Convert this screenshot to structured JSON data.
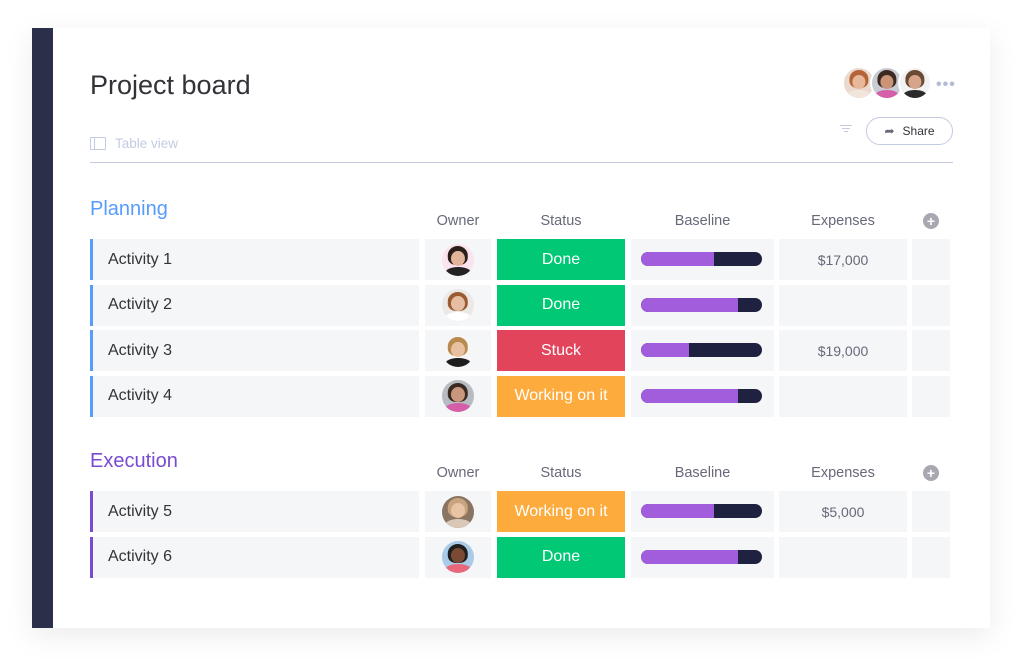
{
  "header": {
    "title": "Project board",
    "view_label": "Table view",
    "share_label": "Share",
    "more_label": "•••",
    "add_column_label": "+",
    "members": [
      {
        "name": "member-1",
        "bg": "#e9d9cf",
        "hair": "#b5643a",
        "skin": "#e8b89a",
        "shirt": "#f1e5dc"
      },
      {
        "name": "member-2",
        "bg": "#c9ccd4",
        "hair": "#3b2a20",
        "skin": "#c99478",
        "shirt": "#d45fa8"
      },
      {
        "name": "member-3",
        "bg": "#f2f2f2",
        "hair": "#6b4a33",
        "skin": "#d6a48a",
        "shirt": "#2b2b2b"
      }
    ]
  },
  "columns": {
    "owner": "Owner",
    "status": "Status",
    "baseline": "Baseline",
    "expenses": "Expenses"
  },
  "statuses": {
    "Done": "#00c875",
    "Stuck": "#e2445c",
    "Working on it": "#fdab3d"
  },
  "groups": [
    {
      "title": "Planning",
      "color": "#579bfc",
      "rows": [
        {
          "name": "Activity 1",
          "status": "Done",
          "baseline": 0.6,
          "expenses": "$17,000",
          "owner": {
            "bg": "#fbe3ef",
            "hair": "#2b1f1a",
            "skin": "#e2b59a",
            "shirt": "#222222"
          }
        },
        {
          "name": "Activity 2",
          "status": "Done",
          "baseline": 0.8,
          "expenses": "",
          "owner": {
            "bg": "#ece8e6",
            "hair": "#9a5a32",
            "skin": "#e7bea3",
            "shirt": "#ffffff"
          }
        },
        {
          "name": "Activity 3",
          "status": "Stuck",
          "baseline": 0.4,
          "expenses": "$19,000",
          "owner": {
            "bg": "#f6f6f6",
            "hair": "#b98a4f",
            "skin": "#e9c0a0",
            "shirt": "#1d1d1d"
          }
        },
        {
          "name": "Activity 4",
          "status": "Working on it",
          "baseline": 0.8,
          "expenses": "",
          "owner": {
            "bg": "#b8bbc2",
            "hair": "#3a2a22",
            "skin": "#c9977b",
            "shirt": "#d45fa8"
          }
        }
      ]
    },
    {
      "title": "Execution",
      "color": "#784bd1",
      "rows": [
        {
          "name": "Activity 5",
          "status": "Working on it",
          "baseline": 0.6,
          "expenses": "$5,000",
          "owner": {
            "bg": "#8a7462",
            "hair": "#c9a57f",
            "skin": "#eac3a5",
            "shirt": "#d9c8b8"
          }
        },
        {
          "name": "Activity 6",
          "status": "Done",
          "baseline": 0.8,
          "expenses": "",
          "owner": {
            "bg": "#a9cbe8",
            "hair": "#1f1f1f",
            "skin": "#7a4a34",
            "shirt": "#e8677a"
          }
        }
      ]
    }
  ]
}
